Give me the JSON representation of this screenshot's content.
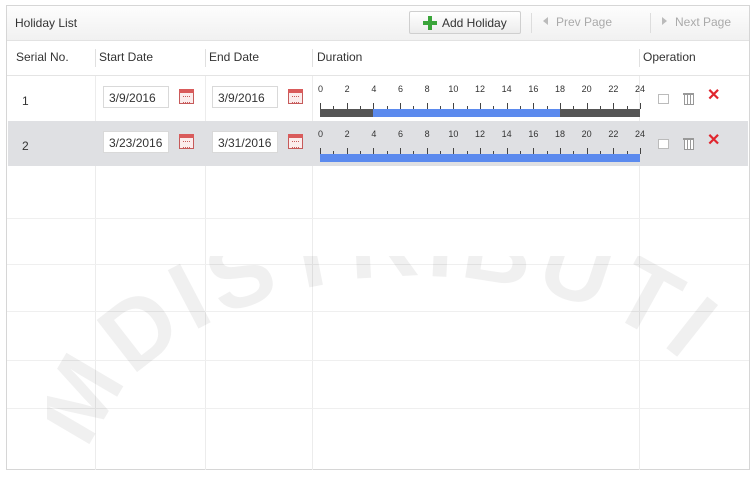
{
  "window": {
    "title": "Holiday List",
    "add_button": "Add Holiday",
    "prev_page": "Prev Page",
    "next_page": "Next Page"
  },
  "columns": [
    "Serial No.",
    "Start Date",
    "End Date",
    "Duration",
    "Operation"
  ],
  "timeline_labels": [
    "0",
    "2",
    "4",
    "6",
    "8",
    "10",
    "12",
    "14",
    "16",
    "18",
    "20",
    "22",
    "24"
  ],
  "rows": [
    {
      "serial": "1",
      "start": "3/9/2016",
      "end": "3/9/2016",
      "duration_hours": [
        4,
        18
      ]
    },
    {
      "serial": "2",
      "start": "3/23/2016",
      "end": "3/31/2016",
      "duration_hours": [
        0,
        24
      ]
    }
  ],
  "watermark": "MDISTRIBUTI",
  "colors": {
    "accent_add": "#3aa53a",
    "timeline_fill": "#5b8aee",
    "timeline_bg": "#555555",
    "delete": "#e0262e",
    "selected_row": "#dfe0e3"
  }
}
